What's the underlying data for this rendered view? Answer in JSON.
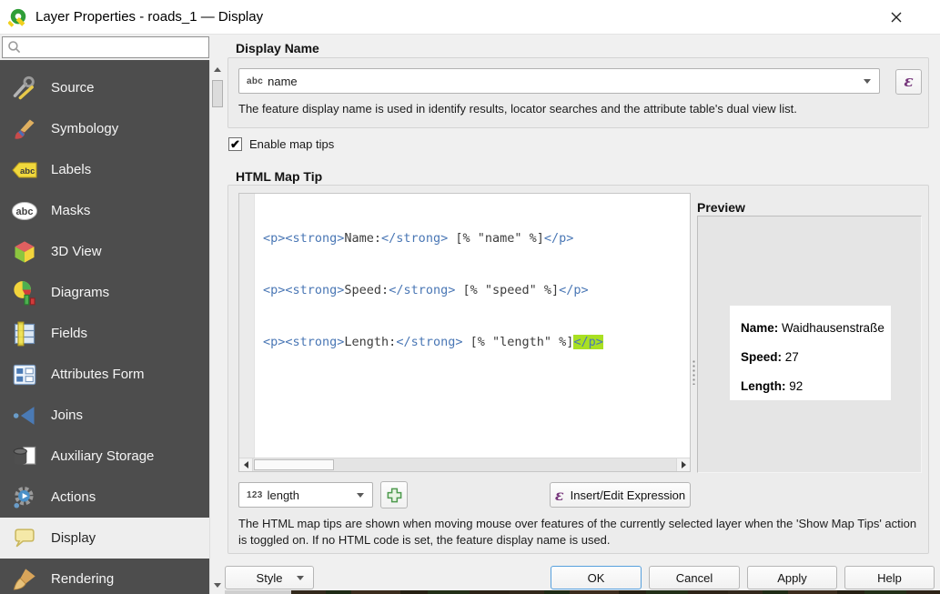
{
  "window": {
    "title": "Layer Properties - roads_1 — Display"
  },
  "sidebar": {
    "search_value": "",
    "selected": "Display",
    "items": [
      {
        "label": "Source"
      },
      {
        "label": "Symbology"
      },
      {
        "label": "Labels"
      },
      {
        "label": "Masks"
      },
      {
        "label": "3D View"
      },
      {
        "label": "Diagrams"
      },
      {
        "label": "Fields"
      },
      {
        "label": "Attributes Form"
      },
      {
        "label": "Joins"
      },
      {
        "label": "Auxiliary Storage"
      },
      {
        "label": "Actions"
      },
      {
        "label": "Display"
      },
      {
        "label": "Rendering"
      }
    ]
  },
  "display_name": {
    "header": "Display Name",
    "field_type_badge": "abc",
    "value": "name",
    "expression_symbol": "ε",
    "help": "The feature display name is used in identify results, locator searches and the attribute table's dual view list."
  },
  "map_tips": {
    "enable_label": "Enable map tips",
    "enabled": true,
    "checkmark": "✔",
    "header": "HTML Map Tip",
    "code_lines": [
      {
        "segments": [
          {
            "t": "<p><strong>"
          },
          {
            "t": "Name:"
          },
          {
            "t": "</strong>"
          },
          {
            "t": " [% \"name\" %]"
          },
          {
            "t": "</p>"
          }
        ]
      },
      {
        "segments": [
          {
            "t": "<p><strong>"
          },
          {
            "t": "Speed:"
          },
          {
            "t": "</strong>"
          },
          {
            "t": " [% \"speed\" %]"
          },
          {
            "t": "</p>"
          }
        ]
      },
      {
        "segments": [
          {
            "t": "<p><strong>"
          },
          {
            "t": "Length:"
          },
          {
            "t": "</strong>"
          },
          {
            "t": " [% \"length\" %]"
          },
          {
            "t": "</p>"
          }
        ]
      }
    ],
    "preview": {
      "header": "Preview",
      "rows": [
        {
          "label": "Name:",
          "value": " Waidhausenstraße"
        },
        {
          "label": "Speed:",
          "value": " 27"
        },
        {
          "label": "Length:",
          "value": " 92"
        }
      ]
    },
    "field_combo": {
      "type_badge": "123",
      "value": "length"
    },
    "insert_expression": {
      "symbol": "ε",
      "label": "Insert/Edit Expression"
    },
    "help": "The HTML map tips are shown when moving mouse over features of the currently selected layer when the 'Show Map Tips' action is toggled on. If no HTML code is set, the feature display name is used."
  },
  "footer": {
    "style": "Style",
    "ok": "OK",
    "cancel": "Cancel",
    "apply": "Apply",
    "help": "Help"
  },
  "colors": {
    "sidebar_bg": "#4d4d4d",
    "selected_item_bg": "#eeeeee",
    "code_tag_blue": "#4a77b5",
    "code_text": "#3c3c3c",
    "bracket_highlight": "#a9e022",
    "epsilon_purple": "#76357b",
    "plus_green": "#4e9a4e",
    "ok_button_border": "#57a0dd",
    "logo_green": "#2f9e38",
    "logo_yellow": "#f0d01e"
  }
}
